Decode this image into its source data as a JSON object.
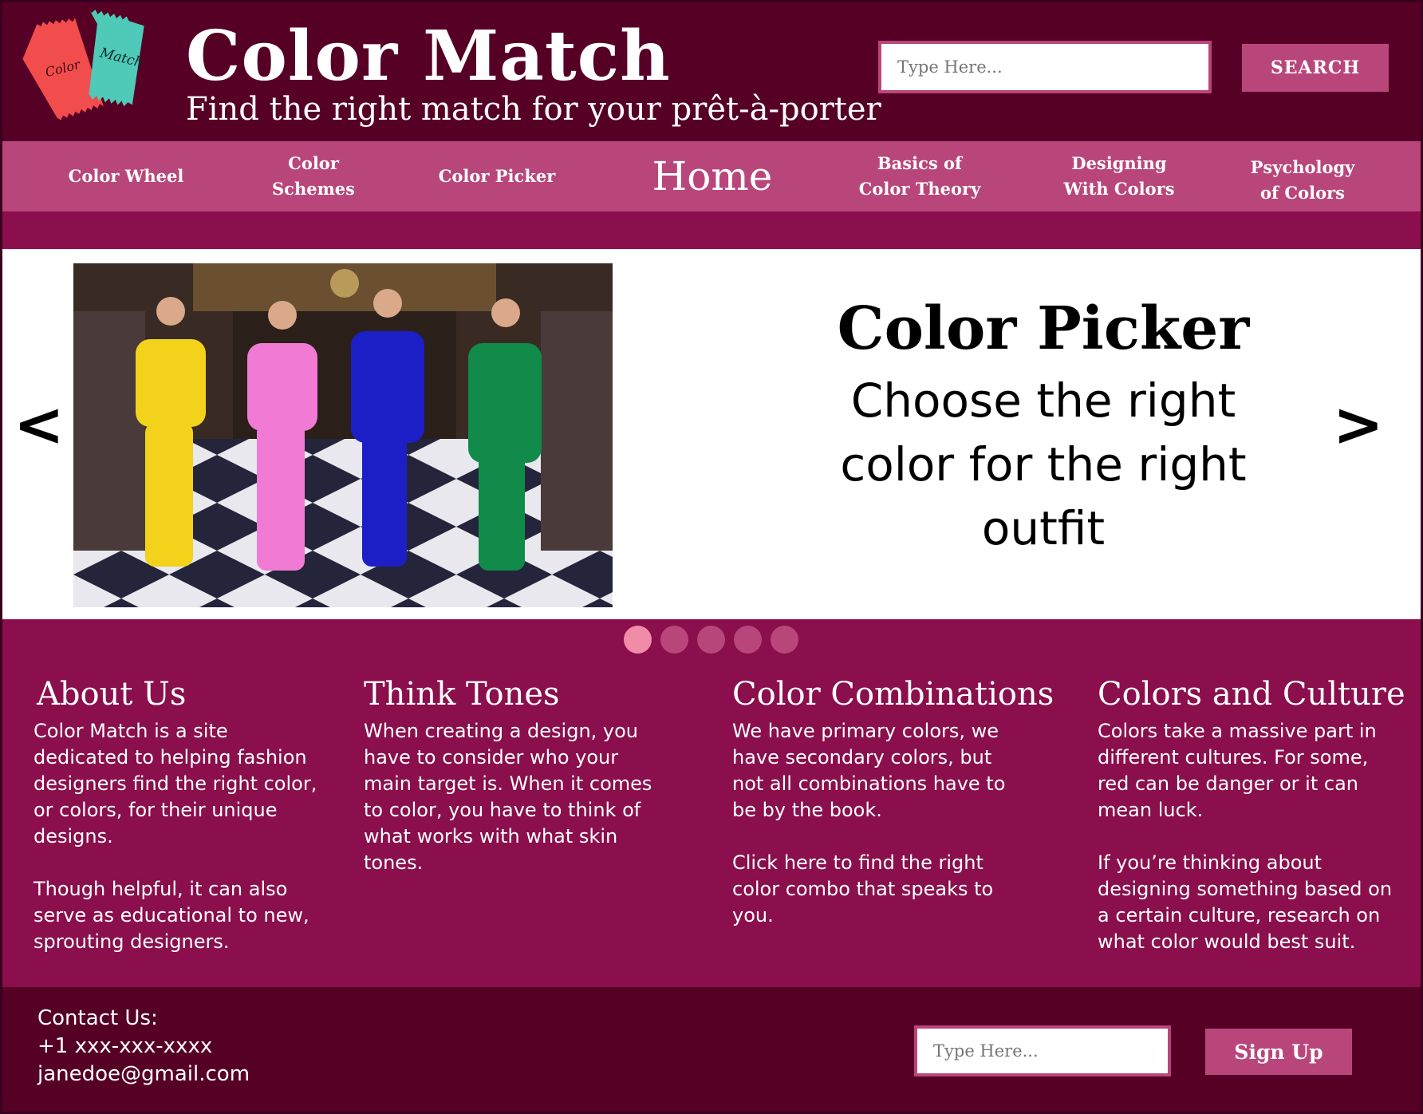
{
  "header": {
    "logo_swatch_1_text": "Color",
    "logo_swatch_2_text": "Match",
    "title": "Color Match",
    "subtitle": "Find the right match for your prêt-à-porter",
    "search_placeholder": "Type Here...",
    "search_button": "SEARCH"
  },
  "nav": {
    "items": [
      {
        "label": "Color Wheel"
      },
      {
        "label": "Color\nSchemes"
      },
      {
        "label": "Color Picker"
      },
      {
        "label": "Home"
      },
      {
        "label": "Basics of\nColor Theory"
      },
      {
        "label": "Designing\nWith Colors"
      },
      {
        "label": "Psychology\nof Colors"
      }
    ]
  },
  "hero": {
    "prev_arrow": "<",
    "next_arrow": ">",
    "title": "Color Picker",
    "subtitle": "Choose the right color for the right outfit",
    "slide_count": 5,
    "active_slide": 1
  },
  "columns": [
    {
      "heading": "About Us",
      "paragraphs": [
        "Color Match is a site dedicated to helping fashion designers find the right color, or colors, for their unique designs.",
        "Though helpful, it can also serve as educational to new, sprouting designers."
      ]
    },
    {
      "heading": "Think Tones",
      "paragraphs": [
        "When creating a design, you have to consider who your main target is. When it comes to color, you have to think of what works with what skin tones."
      ]
    },
    {
      "heading": "Color Combinations",
      "paragraphs": [
        "We have primary colors, we have secondary colors, but not all combinations have to be by the book.",
        "Click here to find the right color combo that speaks to you."
      ]
    },
    {
      "heading": "Colors and Culture",
      "paragraphs": [
        "Colors take a massive part in different cultures. For some, red can be danger or it can mean luck.",
        "If you’re thinking about designing something based on a certain culture, research on what color would best suit."
      ]
    }
  ],
  "footer": {
    "contact_label": "Contact Us:",
    "phone": "+1 xxx-xxx-xxxx",
    "email": "janedoe@gmail.com",
    "signup_placeholder": "Type Here...",
    "signup_button": "Sign Up"
  },
  "colors": {
    "header_bg": "#560026",
    "nav_bg": "#b9467a",
    "page_bg": "#8a0f4c",
    "dot_active": "#f18ca8",
    "swatch_red": "#f24d4d",
    "swatch_teal": "#4fc9b8"
  }
}
